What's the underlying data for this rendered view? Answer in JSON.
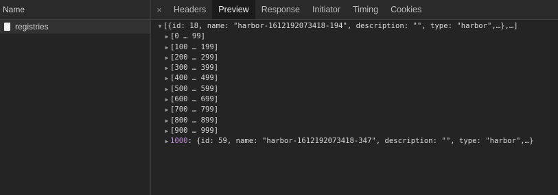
{
  "sidebar": {
    "header": "Name",
    "requests": [
      {
        "name": "registries",
        "icon": "file-icon"
      }
    ]
  },
  "tabs": {
    "close_glyph": "×",
    "items": [
      {
        "label": "Headers"
      },
      {
        "label": "Preview",
        "active": true
      },
      {
        "label": "Response"
      },
      {
        "label": "Initiator"
      },
      {
        "label": "Timing"
      },
      {
        "label": "Cookies"
      }
    ]
  },
  "preview": {
    "root_summary": "[{id: 18, name: \"harbor-1612192073418-194\", description: \"\", type: \"harbor\",…},…]",
    "ranges": [
      "[0 … 99]",
      "[100 … 199]",
      "[200 … 299]",
      "[300 … 399]",
      "[400 … 499]",
      "[500 … 599]",
      "[600 … 699]",
      "[700 … 799]",
      "[800 … 899]",
      "[900 … 999]"
    ],
    "last_item": {
      "key": "1000",
      "value": ": {id: 59, name: \"harbor-1612192073418-347\", description: \"\", type: \"harbor\",…}"
    }
  },
  "colors": {
    "background": "#242424",
    "active_tab": "#1b1b1b",
    "key_purple": "#c38fe0"
  }
}
